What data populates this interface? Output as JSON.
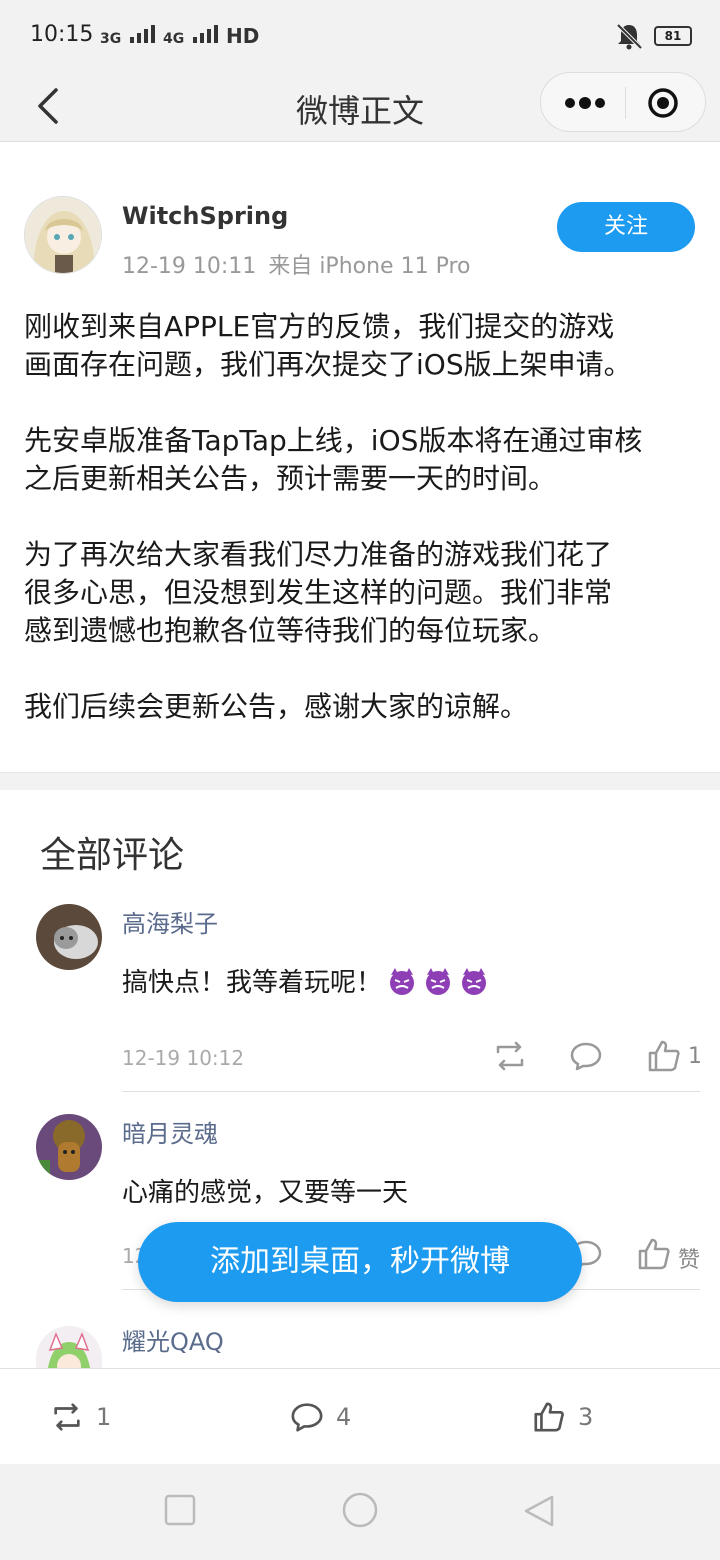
{
  "status_bar": {
    "time": "10:15",
    "network": [
      "3G",
      "4G",
      "HD"
    ],
    "battery": "81"
  },
  "nav": {
    "title": "微博正文"
  },
  "post": {
    "username": "WitchSpring",
    "timestamp": "12-19 10:11",
    "source": "来自 iPhone 11 Pro",
    "follow_label": "关注",
    "paragraphs": [
      "刚收到来自APPLE官方的反馈，我们提交的游戏\n画面存在问题，我们再次提交了iOS版上架申请。",
      "先安卓版准备TapTap上线，iOS版本将在通过审核\n之后更新相关公告，预计需要一天的时间。",
      "为了再次给大家看我们尽力准备的游戏我们花了\n很多心思，但没想到发生这样的问题。我们非常\n感到遗憾也抱歉各位等待我们的每位玩家。",
      "我们后续会更新公告，感谢大家的谅解。"
    ]
  },
  "comments_title": "全部评论",
  "comments": [
    {
      "name": "高海梨子",
      "text": "搞快点！我等着玩呢！",
      "time": "12-19 10:12",
      "likes": "1"
    },
    {
      "name": "暗月灵魂",
      "text": "心痛的感觉，又要等一天",
      "time": "12",
      "likes": "赞"
    },
    {
      "name": "耀光QAQ"
    }
  ],
  "toast": "添加到桌面，秒开微博",
  "action_bar": {
    "reposts": "1",
    "comments": "4",
    "likes": "3"
  },
  "colors": {
    "accent": "#1d9bf0",
    "username_link": "#5a6b8c"
  }
}
